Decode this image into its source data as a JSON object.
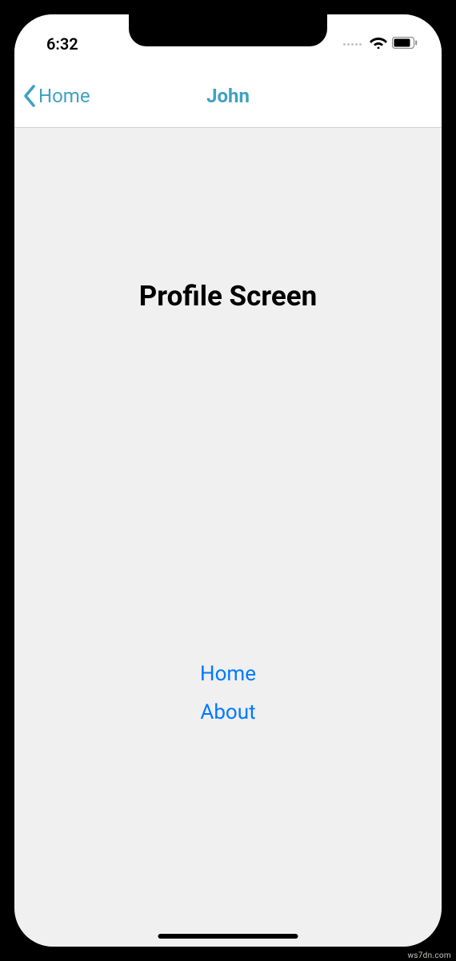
{
  "status_bar": {
    "time": "6:32"
  },
  "nav": {
    "back_label": "Home",
    "title": "John"
  },
  "content": {
    "heading": "Profile Screen",
    "links": {
      "home": "Home",
      "about": "About"
    }
  },
  "watermark": "ws7dn.com"
}
